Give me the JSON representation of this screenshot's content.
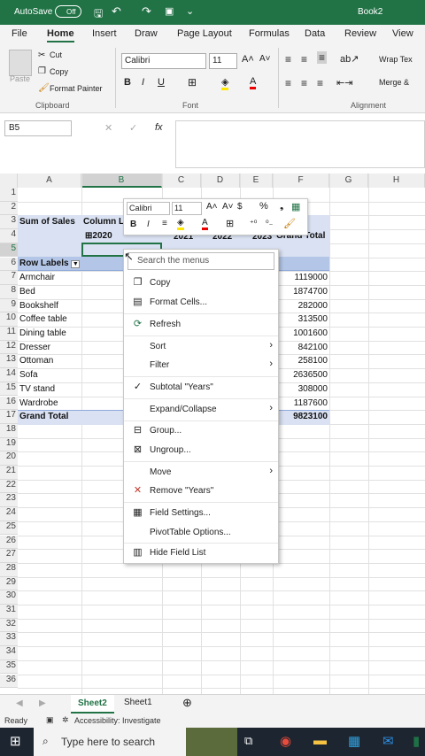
{
  "titlebar": {
    "autosave": "AutoSave",
    "toggle": "Off",
    "doc": "Book2"
  },
  "tabs": [
    "File",
    "Home",
    "Insert",
    "Draw",
    "Page Layout",
    "Formulas",
    "Data",
    "Review",
    "View"
  ],
  "ribbon": {
    "paste": "Paste",
    "cut": "Cut",
    "copy": "Copy",
    "format_painter": "Format Painter",
    "clipboard": "Clipboard",
    "font_name": "Calibri",
    "font_size": "11",
    "font_group": "Font",
    "wrap": "Wrap Tex",
    "merge": "Merge &",
    "alignment": "Alignment"
  },
  "namebox": "B5",
  "fx": "fx",
  "columns": [
    "A",
    "B",
    "C",
    "D",
    "E",
    "F",
    "G",
    "H"
  ],
  "rows": [
    "1",
    "2",
    "3",
    "4",
    "5",
    "6",
    "7",
    "8",
    "9",
    "10",
    "11",
    "12",
    "13",
    "14",
    "15",
    "16",
    "17",
    "18",
    "19",
    "20",
    "21",
    "22",
    "23",
    "24",
    "25",
    "26",
    "27",
    "28",
    "29",
    "30",
    "31",
    "32",
    "33",
    "34",
    "35",
    "36"
  ],
  "pivot": {
    "sum_of_sales": "Sum of Sales",
    "column_labels": "Column L",
    "year_2020": "2020",
    "year_2021": "2021",
    "year_2022": "2022",
    "year_2023": "2023",
    "grand_total_col": "Grand Total",
    "row_labels": "Row Labels",
    "items": [
      {
        "name": "Armchair",
        "total": "1119000"
      },
      {
        "name": "Bed",
        "total": "1874700"
      },
      {
        "name": "Bookshelf",
        "total": "282000"
      },
      {
        "name": "Coffee table",
        "total": "313500"
      },
      {
        "name": "Dining table",
        "total": "1001600"
      },
      {
        "name": "Dresser",
        "total": "842100"
      },
      {
        "name": "Ottoman",
        "total": "258100"
      },
      {
        "name": "Sofa",
        "total": "2636500"
      },
      {
        "name": "TV stand",
        "total": "308000"
      },
      {
        "name": "Wardrobe",
        "total": "1187600"
      }
    ],
    "grand_total": "Grand Total",
    "grand_total_value": "9823100"
  },
  "mini_toolbar": {
    "font": "Calibri",
    "size": "11"
  },
  "context_menu": {
    "search": "Search the menus",
    "items": [
      "Copy",
      "Format Cells...",
      "Refresh",
      "Sort",
      "Filter",
      "Subtotal \"Years\"",
      "Expand/Collapse",
      "Group...",
      "Ungroup...",
      "Move",
      "Remove \"Years\"",
      "Field Settings...",
      "PivotTable Options...",
      "Hide Field List"
    ]
  },
  "sheets": [
    "Sheet2",
    "Sheet1"
  ],
  "status": {
    "ready": "Ready",
    "accessibility": "Accessibility: Investigate"
  },
  "taskbar": {
    "search": "Type here to search"
  },
  "colors": {
    "excel_green": "#217346",
    "pivot_band": "#d9e1f2",
    "pivot_header": "#b4c6e7"
  }
}
